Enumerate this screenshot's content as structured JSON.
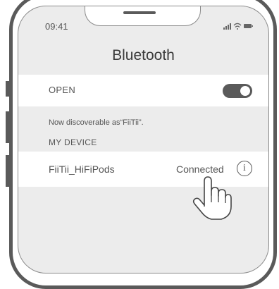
{
  "status_bar": {
    "time": "09:41",
    "icons": [
      "cellular-icon",
      "wifi-icon",
      "battery-icon"
    ]
  },
  "nav": {
    "title": "Bluetooth"
  },
  "bluetooth_toggle": {
    "label": "OPEN",
    "state": "on"
  },
  "discoverable_text": "Now discoverable as“FiiTii”.",
  "my_device": {
    "header": "MY DEVICE",
    "devices": [
      {
        "name": "FiiTii_HiFiPods",
        "status": "Connected",
        "info_glyph": "i"
      }
    ]
  },
  "hand_icon": "pointing-hand-icon",
  "colors": {
    "frame": "#5a5a5a",
    "screen_bg": "#ececec",
    "row_bg": "#ffffff",
    "text": "#555555"
  }
}
